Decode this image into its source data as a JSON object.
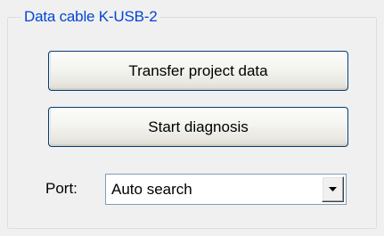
{
  "groupbox": {
    "title": "Data cable K-USB-2",
    "title_color": "#0046d5"
  },
  "buttons": {
    "transfer_label": "Transfer project data",
    "diagnosis_label": "Start diagnosis"
  },
  "port": {
    "label": "Port:",
    "selected_value": "Auto search",
    "dropdown_icon": "chevron-down-icon"
  }
}
